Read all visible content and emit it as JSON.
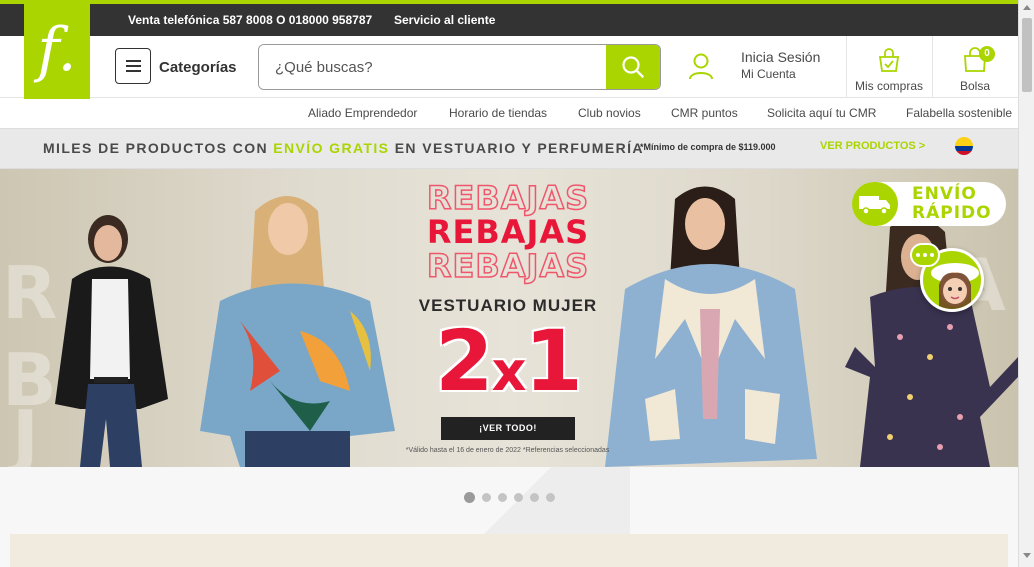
{
  "brand": {
    "logo_letter": "f.",
    "accent": "#aad500"
  },
  "topbar": {
    "phone": "Venta telefónica 587 8008 O 018000 958787",
    "service": "Servicio al cliente"
  },
  "header": {
    "categories_label": "Categorías",
    "search_placeholder": "¿Qué buscas?",
    "login_title": "Inicia Sesión",
    "login_sub": "Mi Cuenta",
    "purchases_label": "Mis compras",
    "bag_label": "Bolsa",
    "bag_count": "0"
  },
  "subnav": {
    "items": [
      "Aliado Emprendedor",
      "Horario de tiendas",
      "Club novios",
      "CMR puntos",
      "Solicita aquí tu CMR",
      "Falabella sostenible"
    ]
  },
  "promo": {
    "text_before": "MILES DE PRODUCTOS CON ",
    "highlight": "ENVÍO GRATIS",
    "text_after": " EN VESTUARIO Y PERFUMERÍA",
    "minimum": "*Mínimo de compra de $119.000",
    "cta": "VER PRODUCTOS >"
  },
  "banner": {
    "rebajas": "REBAJAS",
    "subtitle": "VESTUARIO MUJER",
    "offer_a": "2",
    "offer_x": "x",
    "offer_b": "1",
    "cta": "¡VER TODO!",
    "validity": "*Válido hasta el 16 de enero de 2022 *Referencias seleccionadas",
    "envio_line1": "ENVÍO",
    "envio_line2": "RÁPIDO",
    "bg_letters": [
      "R",
      "B",
      "J",
      "B",
      "A"
    ]
  },
  "carousel": {
    "total": 6,
    "active": 1
  },
  "scrollbar": {
    "position": 0
  }
}
